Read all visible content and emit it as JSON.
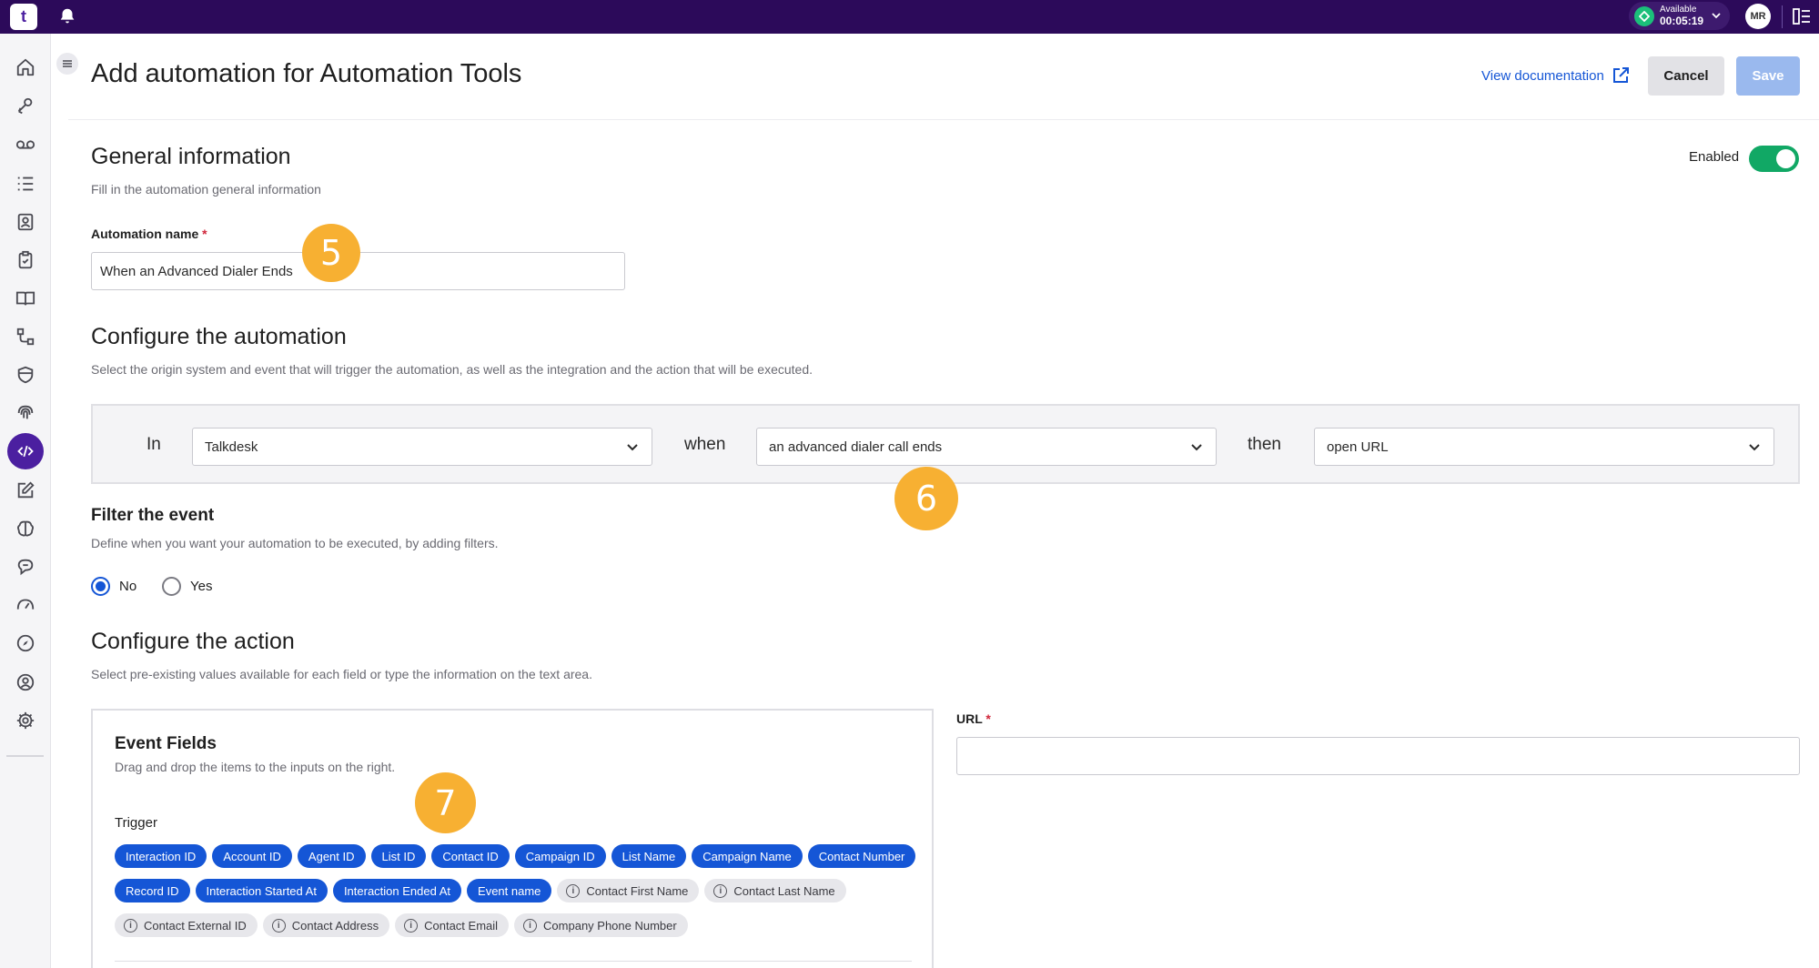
{
  "topbar": {
    "logo_text": "t",
    "status_label": "Available",
    "status_time": "00:05:19",
    "avatar_initials": "MR",
    "colors": {
      "bar": "#2c0a5a",
      "status": "#1bbf7a"
    }
  },
  "nav": {
    "items": [
      "home-icon",
      "pen-tool-icon",
      "voicemail-icon",
      "list-icon",
      "contacts-icon",
      "clipboard-check-icon",
      "book-icon",
      "workflow-icon",
      "shield-icon",
      "fingerprint-icon",
      "code-icon",
      "edit-icon",
      "brain-icon",
      "chat-icon",
      "gauge-icon",
      "compass-icon",
      "user-circle-icon",
      "gear-icon"
    ],
    "active": "code-icon"
  },
  "header": {
    "title": "Add automation for Automation Tools",
    "doc_link": "View documentation",
    "cancel_label": "Cancel",
    "save_label": "Save"
  },
  "general": {
    "title": "General information",
    "subtitle": "Fill in the automation general information",
    "enabled_label": "Enabled",
    "enabled": true,
    "name_label": "Automation name",
    "name_required": "*",
    "name_value": "When an Advanced Dialer Ends"
  },
  "configure": {
    "title": "Configure the automation",
    "subtitle": "Select the origin system and event that will trigger the automation, as well as the integration and the action that will be executed.",
    "in_label": "In",
    "in_value": "Talkdesk",
    "when_label": "when",
    "when_value": "an advanced dialer call ends",
    "then_label": "then",
    "then_value": "open URL"
  },
  "filter": {
    "title": "Filter the event",
    "subtitle": "Define when you want your automation to be executed, by adding filters.",
    "options": [
      "No",
      "Yes"
    ],
    "selected": "No"
  },
  "action": {
    "title": "Configure the action",
    "subtitle": "Select pre-existing values available for each field or type the information on the text area.",
    "event_fields_title": "Event Fields",
    "event_fields_sub": "Drag and drop the items to the inputs on the right.",
    "trigger_label": "Trigger",
    "chips_row1": [
      "Interaction ID",
      "Account ID",
      "Agent ID",
      "List ID",
      "Contact ID",
      "Campaign ID",
      "List Name",
      "Campaign Name",
      "Contact Number"
    ],
    "chips_row2_blue": [
      "Record ID",
      "Interaction Started At",
      "Interaction Ended At",
      "Event name"
    ],
    "chips_row2_grey": [
      "Contact First Name",
      "Contact Last Name"
    ],
    "chips_row3_grey": [
      "Contact External ID",
      "Contact Address",
      "Contact Email",
      "Company Phone Number"
    ],
    "url_label": "URL",
    "url_required": "*",
    "url_value": ""
  },
  "badges": [
    "5",
    "6",
    "7"
  ]
}
